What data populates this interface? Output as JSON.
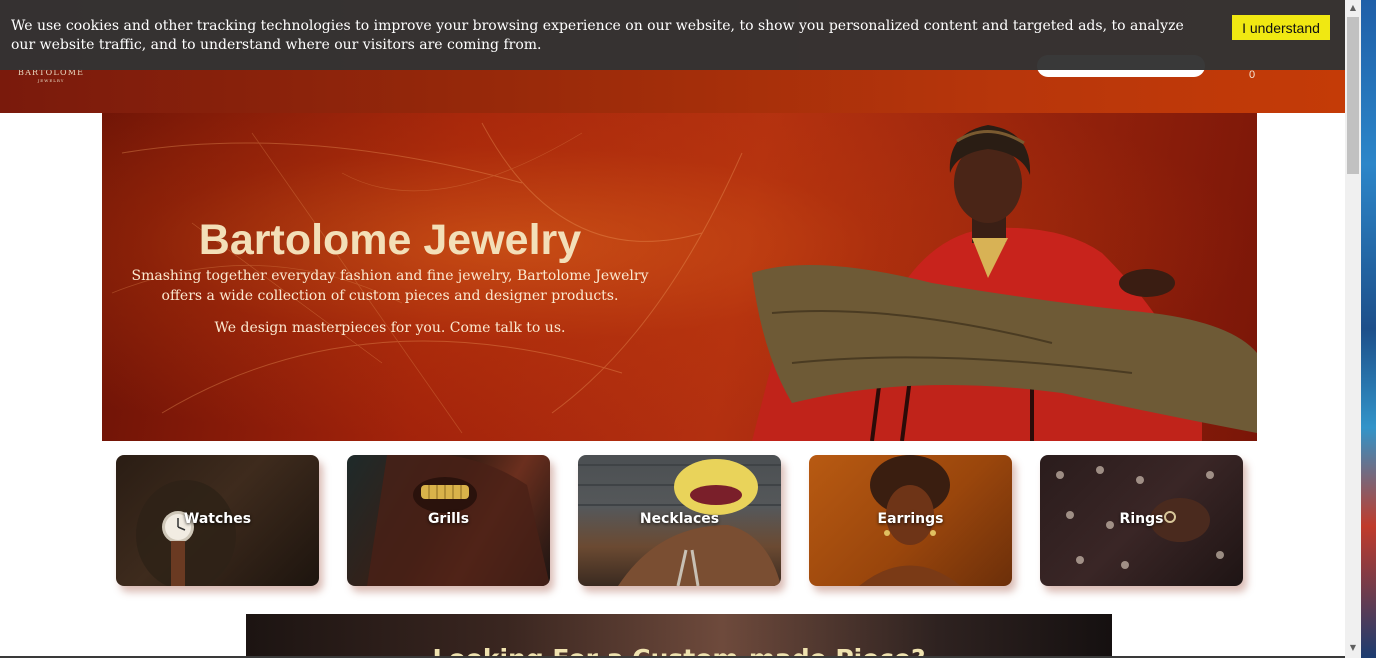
{
  "cookie_banner": {
    "text": "We use cookies and other tracking technologies to improve your browsing experience on our website, to show you personalized content and targeted ads, to analyze our website traffic, and to understand where our visitors are coming from.",
    "button_label": "I understand"
  },
  "header": {
    "logo_line1": "BARTOLOME",
    "logo_line2": "JEWELRY",
    "cart_count": "0"
  },
  "hero": {
    "title": "Bartolome Jewelry",
    "subtitle": "Smashing together everyday fashion and fine jewelry, Bartolome Jewelry offers a wide collection of custom pieces and designer products.",
    "cta": "We design masterpieces for you. Come talk to us."
  },
  "categories": [
    {
      "label": "Watches"
    },
    {
      "label": "Grills"
    },
    {
      "label": "Necklaces"
    },
    {
      "label": "Earrings"
    },
    {
      "label": "Rings"
    }
  ],
  "custom_section": {
    "heading": "Looking For a Custom-made Piece?"
  },
  "colors": {
    "header_gradient_start": "#7a1a0c",
    "header_gradient_end": "#c43b07",
    "cookie_banner_bg": "#333333",
    "cookie_button_bg": "#f0e812",
    "hero_title": "#f3dfb8"
  },
  "icons": [
    "shopping-cart-icon",
    "scroll-up-arrow-icon",
    "scroll-down-arrow-icon"
  ]
}
